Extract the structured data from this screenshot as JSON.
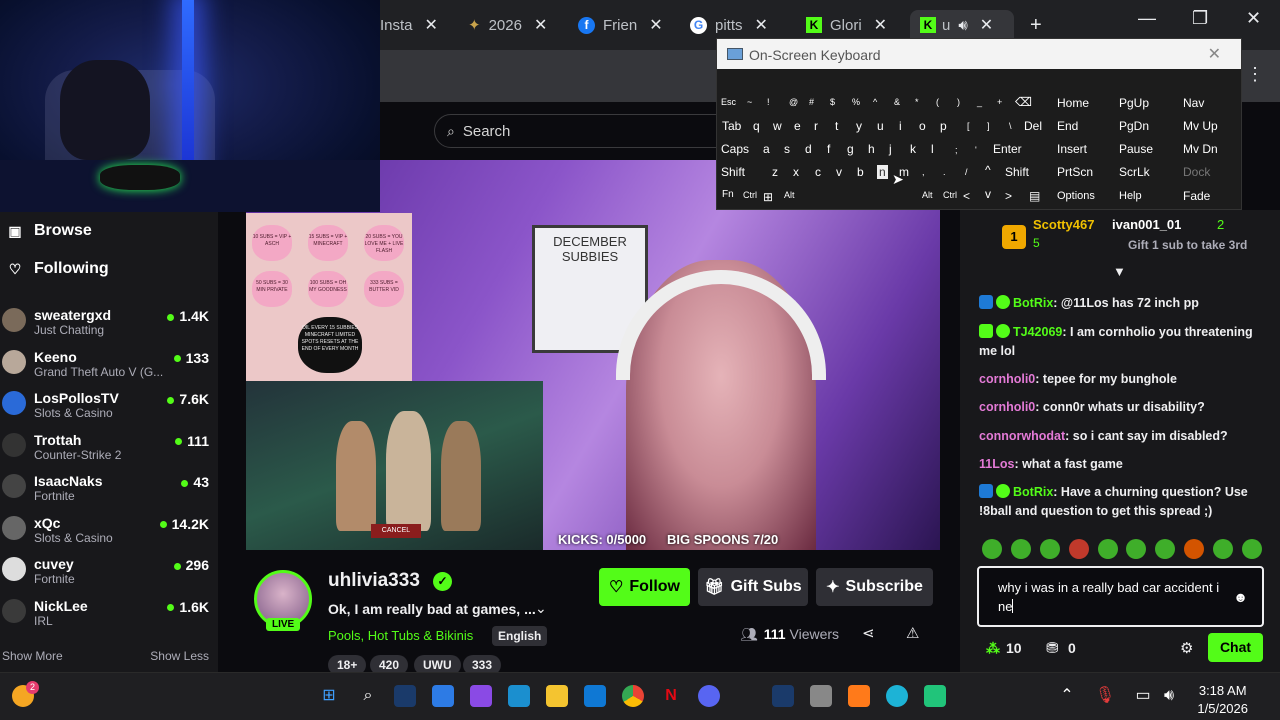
{
  "browser": {
    "tabs": [
      {
        "label": "Insta",
        "icon": "instagram-icon"
      },
      {
        "label": "2026",
        "icon": "star-icon"
      },
      {
        "label": "Frien",
        "icon": "facebook-icon"
      },
      {
        "label": "pitts",
        "icon": "google-icon"
      },
      {
        "label": "Glori",
        "icon": "kick-icon"
      },
      {
        "label": "u",
        "icon": "kick-icon"
      }
    ],
    "new_tab": "+"
  },
  "osk": {
    "title": "On-Screen Keyboard",
    "rows": [
      [
        "Esc",
        "~",
        "!",
        "@",
        "#",
        "$",
        "%",
        "^",
        "&",
        "*",
        "(",
        ")",
        "_",
        "+",
        "⌫",
        "Home",
        "PgUp",
        "Nav"
      ],
      [
        "Tab",
        "q",
        "w",
        "e",
        "r",
        "t",
        "y",
        "u",
        "i",
        "o",
        "p",
        "[",
        "]",
        "\\",
        "Del",
        "End",
        "PgDn",
        "Mv Up"
      ],
      [
        "Caps",
        "a",
        "s",
        "d",
        "f",
        "g",
        "h",
        "j",
        "k",
        "l",
        ";",
        "'",
        "Enter",
        "Insert",
        "Pause",
        "Mv Dn"
      ],
      [
        "Shift",
        "z",
        "x",
        "c",
        "v",
        "b",
        "n",
        "m",
        ",",
        ".",
        "/",
        "^",
        "Shift",
        "PrtScn",
        "ScrLk",
        "Dock"
      ],
      [
        "Fn",
        "Ctrl",
        "⊞",
        "Alt",
        "Alt",
        "Ctrl",
        "<",
        "v",
        ">",
        "▤",
        "Options",
        "Help",
        "Fade"
      ]
    ]
  },
  "site": {
    "search_placeholder": "Search"
  },
  "sidebar": {
    "browse": "Browse",
    "following": "Following",
    "channels": [
      {
        "name": "sweatergxd",
        "game": "Just Chatting",
        "viewers": "1.4K"
      },
      {
        "name": "Keeno",
        "game": "Grand Theft Auto V (G...",
        "viewers": "133"
      },
      {
        "name": "LosPollosTV",
        "game": "Slots & Casino",
        "viewers": "7.6K"
      },
      {
        "name": "Trottah",
        "game": "Counter-Strike 2",
        "viewers": "111"
      },
      {
        "name": "IsaacNaks",
        "game": "Fortnite",
        "viewers": "43"
      },
      {
        "name": "xQc",
        "game": "Slots & Casino",
        "viewers": "14.2K"
      },
      {
        "name": "cuvey",
        "game": "Fortnite",
        "viewers": "296"
      },
      {
        "name": "NickLee",
        "game": "IRL",
        "viewers": "1.6K"
      }
    ],
    "show_more": "Show More",
    "show_less": "Show Less"
  },
  "video": {
    "hearts": [
      "10 SUBS = VIP + ASCH",
      "15 SUBS = VIP + MINECRAFT",
      "20 SUBS = YOU LOVE ME + LIVE FLASH",
      "50 SUBS = 30 MIN PRIVATE",
      "100 SUBS = OH MY GOODNESS",
      "333 SUBS = BUTTER VID",
      "OIL EVERY 15 SUBBIES MINECRAFT LIMITED SPOTS RESETS AT THE END OF EVERY MONTH"
    ],
    "poster_title": "DECEMBER SUBBIES",
    "kicks": "KICKS: 0/5000",
    "spoons": "BIG SPOONS 7/20",
    "game_button": "CANCEL"
  },
  "stream": {
    "username": "uhlivia333",
    "live": "LIVE",
    "title": "Ok, I am really bad at games, ...",
    "category": "Pools, Hot Tubs & Bikinis",
    "language": "English",
    "tags": [
      "18+",
      "420",
      "UWU",
      "333"
    ],
    "viewers_count": "111",
    "viewers_label": "Viewers",
    "follow": "Follow",
    "gift": "Gift Subs",
    "subscribe": "Subscribe"
  },
  "chat": {
    "pin_user1": "Scotty467",
    "pin_count1": "5",
    "pin_user2": "ivan001_01",
    "pin_count2": "2",
    "pin_gift": "Gift 1 sub to take 3rd",
    "messages": [
      {
        "user": "BotRix",
        "text": ": @11Los has 72 inch pp",
        "color": "#53fc18"
      },
      {
        "user": "TJ42069",
        "text": ": I am cornholio you threatening me lol",
        "color": "#53fc18"
      },
      {
        "user": "cornholi0",
        "text": ": tepee for my bunghole",
        "color": "#e37ad6"
      },
      {
        "user": "cornholi0",
        "text": ": conn0r whats ur disability?",
        "color": "#e37ad6"
      },
      {
        "user": "connorwhodat",
        "text": ": so i cant say im disabled?",
        "color": "#e37ad6"
      },
      {
        "user": "11Los",
        "text": ": what a fast game",
        "color": "#e37ad6"
      },
      {
        "user": "BotRix",
        "text": ": Have a churning question? Use !8ball and question to get this spread ;)",
        "color": "#53fc18"
      }
    ],
    "input_value": "why i was in a really bad car accident i ne",
    "points": "10",
    "gifts": "0",
    "send": "Chat"
  },
  "taskbar": {
    "time": "3:18 AM",
    "date": "1/5/2026",
    "notif": "2"
  },
  "colors": {
    "accent": "#53fc18",
    "bg": "#0b0b0f",
    "panel": "#18181b"
  }
}
